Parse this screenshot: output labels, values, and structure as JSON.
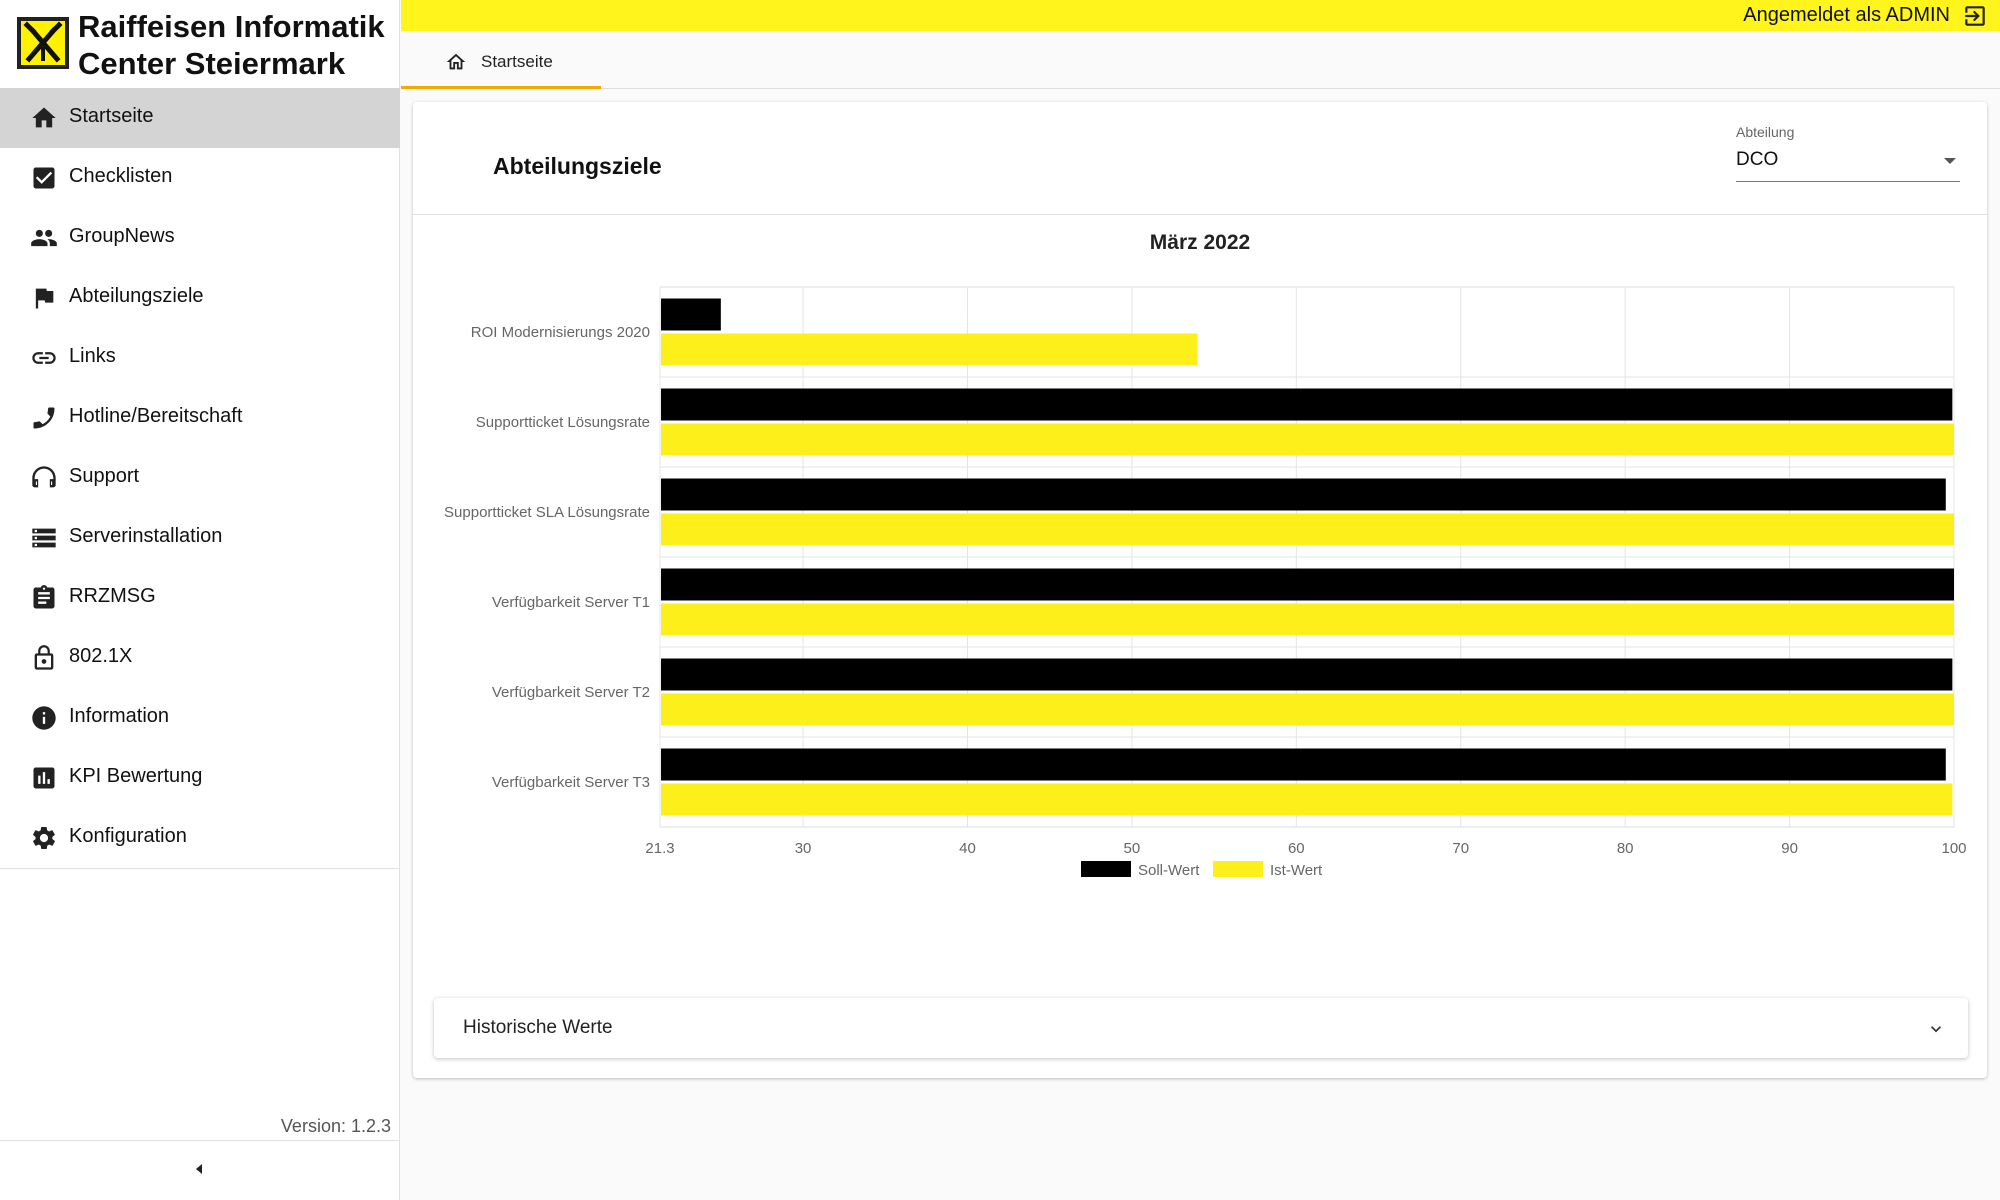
{
  "brand": {
    "title_line1": "Raiffeisen Informatik",
    "title_line2": "Center Steiermark"
  },
  "sidebar": {
    "items": [
      {
        "label": "Startseite",
        "icon": "home-icon",
        "active": true
      },
      {
        "label": "Checklisten",
        "icon": "checkbox-icon"
      },
      {
        "label": "GroupNews",
        "icon": "people-icon"
      },
      {
        "label": "Abteilungsziele",
        "icon": "flag-icon"
      },
      {
        "label": "Links",
        "icon": "link-icon"
      },
      {
        "label": "Hotline/Bereitschaft",
        "icon": "phone-icon"
      },
      {
        "label": "Support",
        "icon": "headset-icon"
      },
      {
        "label": "Serverinstallation",
        "icon": "server-icon"
      },
      {
        "label": "RRZMSG",
        "icon": "clipboard-icon"
      },
      {
        "label": "802.1X",
        "icon": "lock-icon"
      },
      {
        "label": "Information",
        "icon": "info-icon"
      },
      {
        "label": "KPI Bewertung",
        "icon": "chart-icon"
      },
      {
        "label": "Konfiguration",
        "icon": "gear-icon"
      }
    ],
    "version": "Version: 1.2.3"
  },
  "topbar": {
    "user_label": "Angemeldet als ADMIN"
  },
  "tabs": [
    {
      "label": "Startseite",
      "icon": "home-outline-icon"
    }
  ],
  "card": {
    "title": "Abteilungsziele",
    "department": {
      "label": "Abteilung",
      "value": "DCO"
    }
  },
  "panel": {
    "label": "Historische Werte"
  },
  "colors": {
    "accent_yellow": "#fff51c",
    "bar_yellow": "#fdf01a",
    "bar_black": "#000000",
    "tab_underline": "#f4a900"
  },
  "chart_data": {
    "type": "bar",
    "orientation": "horizontal",
    "title": "März 2022",
    "categories": [
      "ROI Modernisierungs 2020",
      "Supportticket Lösungsrate",
      "Supportticket SLA Lösungsrate",
      "Verfügbarkeit Server T1",
      "Verfügbarkeit Server T2",
      "Verfügbarkeit Server T3"
    ],
    "series": [
      {
        "name": "Soll-Wert",
        "color": "#000000",
        "values": [
          25,
          99.9,
          99.5,
          100,
          99.9,
          99.5
        ]
      },
      {
        "name": "Ist-Wert",
        "color": "#fdf01a",
        "values": [
          54,
          100,
          100,
          100,
          100,
          99.9
        ]
      }
    ],
    "xlim": [
      21.3,
      100
    ],
    "x_ticks": [
      "21.3",
      "30",
      "40",
      "50",
      "60",
      "70",
      "80",
      "90",
      "100"
    ],
    "x_tick_values": [
      21.3,
      30,
      40,
      50,
      60,
      70,
      80,
      90,
      100
    ],
    "grid": true,
    "legend": "bottom"
  }
}
